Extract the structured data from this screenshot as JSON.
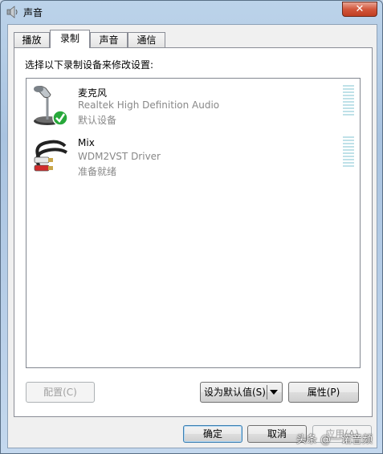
{
  "window": {
    "title": "声音",
    "close_glyph": "✕"
  },
  "tabs": [
    {
      "label": "播放",
      "active": false
    },
    {
      "label": "录制",
      "active": true
    },
    {
      "label": "声音",
      "active": false
    },
    {
      "label": "通信",
      "active": false
    }
  ],
  "panel": {
    "instruction": "选择以下录制设备来修改设置:"
  },
  "devices": [
    {
      "name": "麦克风",
      "description": "Realtek High Definition Audio",
      "status": "默认设备",
      "icon": "microphone-icon",
      "is_default": true
    },
    {
      "name": "Mix",
      "description": "WDM2VST Driver",
      "status": "准备就绪",
      "icon": "audio-cable-icon",
      "is_default": false
    }
  ],
  "buttons": {
    "configure": "配置(C)",
    "set_default": "设为默认值(S)",
    "properties": "属性(P)",
    "ok": "确定",
    "cancel": "取消",
    "apply": "应用(A)"
  },
  "watermark": "头条 @一诺音频"
}
